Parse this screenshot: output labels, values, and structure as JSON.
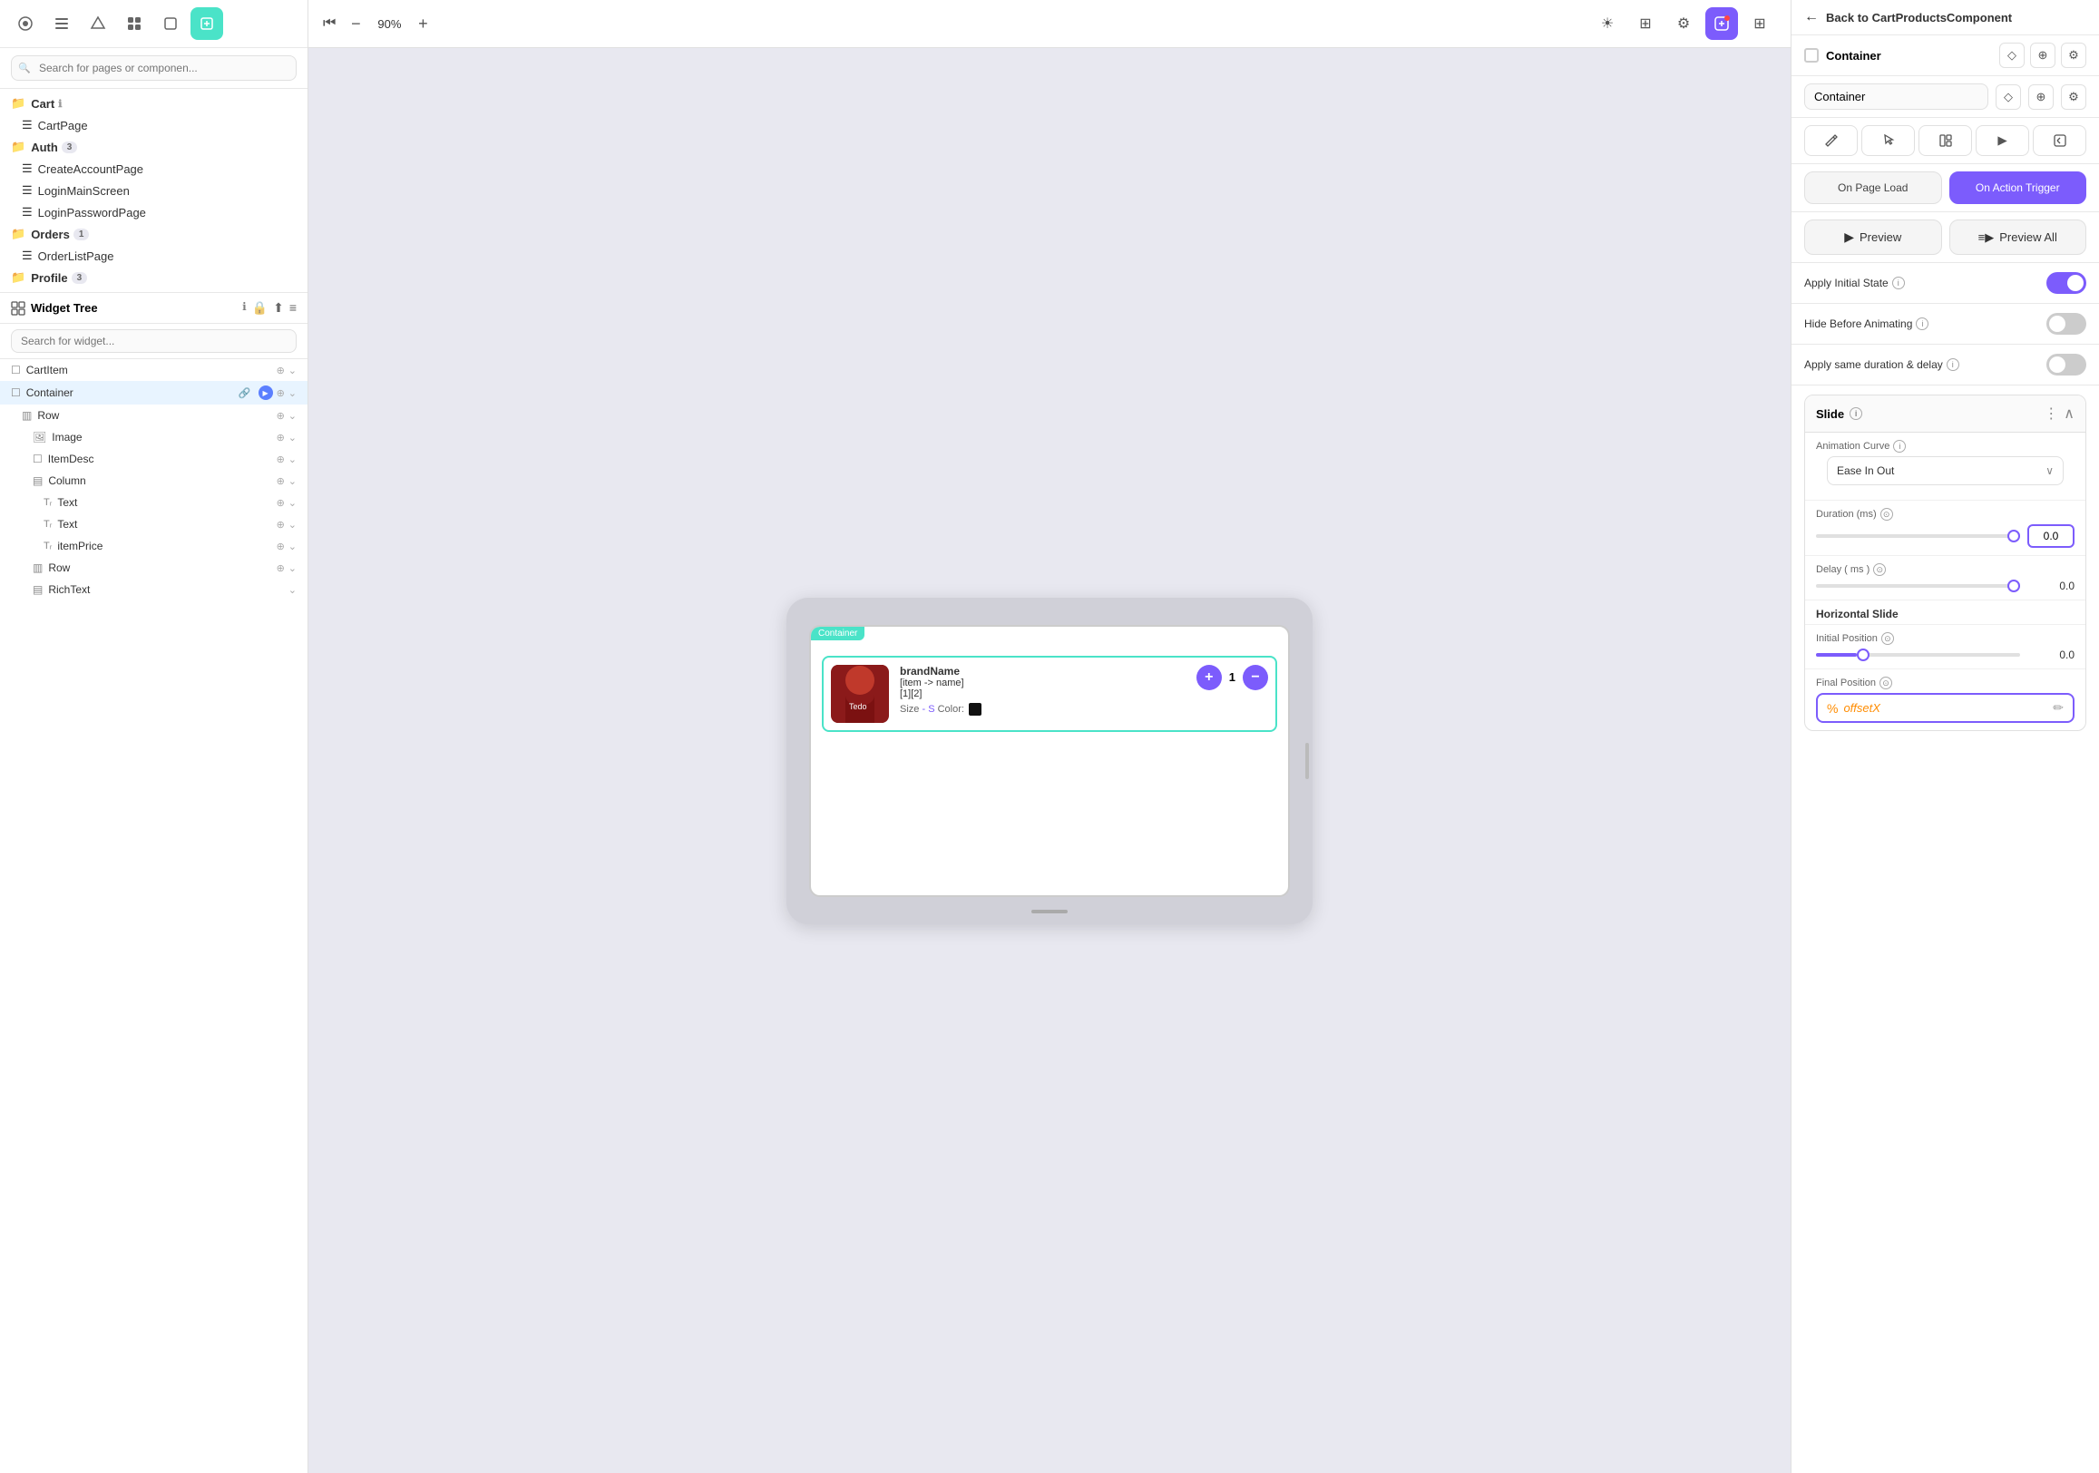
{
  "toolbar": {
    "icons": [
      "⊞",
      "☰",
      "◇",
      "⊡",
      "⬚",
      "⊕"
    ],
    "active_index": 5
  },
  "search": {
    "pages_placeholder": "Search for pages or componen...",
    "widget_placeholder": "Search for widget..."
  },
  "nav_tree": {
    "items": [
      {
        "label": "Cart",
        "type": "folder",
        "badge": "",
        "indent": 0
      },
      {
        "label": "CartPage",
        "type": "page",
        "indent": 1
      },
      {
        "label": "Auth",
        "type": "folder",
        "badge": "3",
        "indent": 0
      },
      {
        "label": "CreateAccountPage",
        "type": "page",
        "indent": 1
      },
      {
        "label": "LoginMainScreen",
        "type": "page",
        "indent": 1
      },
      {
        "label": "LoginPasswordPage",
        "type": "page",
        "indent": 1
      },
      {
        "label": "Orders",
        "type": "folder",
        "badge": "1",
        "indent": 0
      },
      {
        "label": "OrderListPage",
        "type": "page",
        "indent": 1
      },
      {
        "label": "Profile",
        "type": "folder",
        "badge": "3",
        "indent": 0
      }
    ]
  },
  "widget_tree": {
    "title": "Widget Tree",
    "items": [
      {
        "label": "CartItem",
        "indent": 0,
        "icon": "☐",
        "selected": false
      },
      {
        "label": "Container",
        "indent": 0,
        "icon": "☐",
        "selected": true,
        "has_link": true,
        "has_play": true
      },
      {
        "label": "Row",
        "indent": 1,
        "icon": "▥",
        "selected": false
      },
      {
        "label": "Image",
        "indent": 2,
        "icon": "🖼",
        "selected": false
      },
      {
        "label": "ItemDesc",
        "indent": 2,
        "icon": "☐",
        "selected": false
      },
      {
        "label": "Column",
        "indent": 2,
        "icon": "▤",
        "selected": false
      },
      {
        "label": "Text",
        "indent": 3,
        "icon": "Tᵣ",
        "selected": false
      },
      {
        "label": "Text",
        "indent": 3,
        "icon": "Tᵣ",
        "selected": false
      },
      {
        "label": "itemPrice",
        "indent": 3,
        "icon": "Tᵣ",
        "selected": false
      },
      {
        "label": "Row",
        "indent": 2,
        "icon": "▥",
        "selected": false
      },
      {
        "label": "RichText",
        "indent": 2,
        "icon": "▤",
        "selected": false
      }
    ]
  },
  "canvas": {
    "zoom": "90%",
    "container_label": "Container",
    "cart_item": {
      "brand_name": "brandName",
      "item_name": "[item -> name]",
      "qty_display": "[1][2]",
      "size_label": "Size",
      "size_value": "S",
      "color_label": "Color:",
      "qty_count": "1"
    }
  },
  "right_panel": {
    "back_label": "Back to CartProductsComponent",
    "component_label": "Container",
    "input_value": "Container",
    "tabs": {
      "on_page_load": "On Page Load",
      "on_action_trigger": "On Action Trigger"
    },
    "preview": {
      "preview_label": "Preview",
      "preview_all_label": "Preview All"
    },
    "toggles": {
      "apply_initial_state": "Apply Initial State",
      "hide_before_animating": "Hide Before Animating",
      "apply_same_duration": "Apply same duration & delay"
    },
    "slide_section": {
      "title": "Slide",
      "animation_curve_label": "Animation Curve",
      "animation_curve_value": "Ease In Out",
      "duration_label": "Duration (ms)",
      "duration_value": "0.0",
      "delay_label": "Delay ( ms )",
      "delay_value": "0.0",
      "horizontal_slide_label": "Horizontal Slide",
      "initial_position_label": "Initial Position",
      "initial_position_value": "0.0",
      "final_position_label": "Final Position",
      "final_position_value": "offsetX"
    }
  }
}
